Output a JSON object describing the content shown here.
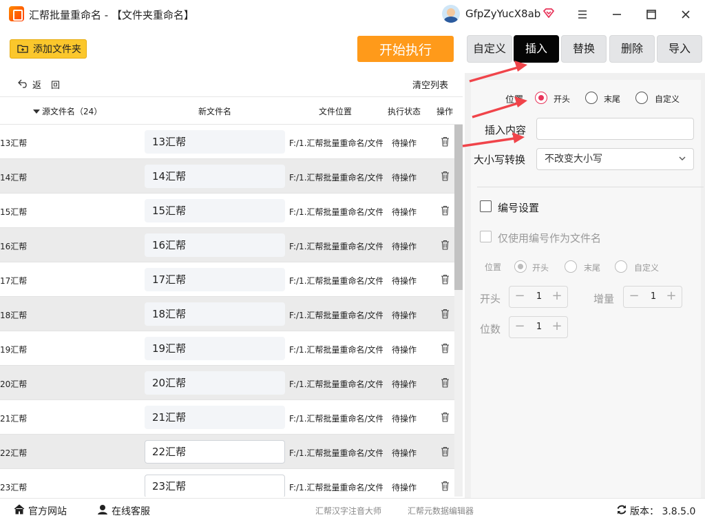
{
  "window": {
    "title": "汇帮批量重命名 - 【文件夹重命名】",
    "user_name": "GfpZyYucX8ab"
  },
  "toolbar": {
    "add_folder_label": "添加文件夹",
    "start_label": "开始执行"
  },
  "listbar": {
    "back_label": "返回",
    "clear_label": "清空列表"
  },
  "table": {
    "columns": {
      "source": "源文件名（24）",
      "new_name": "新文件名",
      "location": "文件位置",
      "status": "执行状态",
      "action": "操作"
    },
    "rows": [
      {
        "source": "13汇帮",
        "new_name": "13汇帮",
        "location": "F:/1.汇帮批量重命名/文件",
        "status": "待操作"
      },
      {
        "source": "14汇帮",
        "new_name": "14汇帮",
        "location": "F:/1.汇帮批量重命名/文件",
        "status": "待操作"
      },
      {
        "source": "15汇帮",
        "new_name": "15汇帮",
        "location": "F:/1.汇帮批量重命名/文件",
        "status": "待操作"
      },
      {
        "source": "16汇帮",
        "new_name": "16汇帮",
        "location": "F:/1.汇帮批量重命名/文件",
        "status": "待操作"
      },
      {
        "source": "17汇帮",
        "new_name": "17汇帮",
        "location": "F:/1.汇帮批量重命名/文件",
        "status": "待操作"
      },
      {
        "source": "18汇帮",
        "new_name": "18汇帮",
        "location": "F:/1.汇帮批量重命名/文件",
        "status": "待操作"
      },
      {
        "source": "19汇帮",
        "new_name": "19汇帮",
        "location": "F:/1.汇帮批量重命名/文件",
        "status": "待操作"
      },
      {
        "source": "20汇帮",
        "new_name": "20汇帮",
        "location": "F:/1.汇帮批量重命名/文件",
        "status": "待操作"
      },
      {
        "source": "21汇帮",
        "new_name": "21汇帮",
        "location": "F:/1.汇帮批量重命名/文件",
        "status": "待操作"
      },
      {
        "source": "22汇帮",
        "new_name": "22汇帮",
        "location": "F:/1.汇帮批量重命名/文件",
        "status": "待操作"
      },
      {
        "source": "23汇帮",
        "new_name": "23汇帮",
        "location": "F:/1.汇帮批量重命名/文件",
        "status": "待操作"
      }
    ]
  },
  "tabs": [
    {
      "label": "自定义",
      "active": false
    },
    {
      "label": "插入",
      "active": true
    },
    {
      "label": "替换",
      "active": false
    },
    {
      "label": "删除",
      "active": false
    },
    {
      "label": "导入",
      "active": false
    }
  ],
  "insert_panel": {
    "position_label": "位置",
    "position_options": [
      "开头",
      "末尾",
      "自定义"
    ],
    "position_selected": "开头",
    "insert_content_label": "插入内容",
    "insert_content_value": "",
    "case_label": "大小写转换",
    "case_value": "不改变大小写"
  },
  "numbering": {
    "enable_label": "编号设置",
    "only_number_label": "仅使用编号作为文件名",
    "position_label": "位置",
    "position_options": [
      "开头",
      "末尾",
      "自定义"
    ],
    "start_label": "开头",
    "start_value": "1",
    "increment_label": "增量",
    "increment_value": "1",
    "digits_label": "位数",
    "digits_value": "1"
  },
  "footer": {
    "site_label": "官方网站",
    "service_label": "在线客服",
    "link1": "汇帮汉字注音大师",
    "link2": "汇帮元数据编辑器",
    "version": "版本： 3.8.5.0"
  },
  "colors": {
    "accent_orange": "#ff9a1a",
    "add_button_yellow": "#fbc72c",
    "radio_selected": "#e8345a",
    "annotation_arrow": "#f0444a",
    "active_tab": "#050505"
  }
}
